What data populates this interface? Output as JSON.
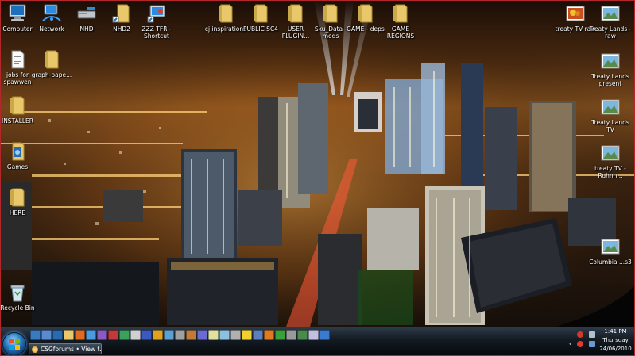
{
  "desktop": {
    "icons": [
      {
        "label": "Computer",
        "icon": "computer-icon"
      },
      {
        "label": "Network",
        "icon": "network-icon"
      },
      {
        "label": "NHD",
        "icon": "drive-icon"
      },
      {
        "label": "NHD2",
        "icon": "folder-shortcut-icon"
      },
      {
        "label": "ZZZ TFR - Shortcut",
        "icon": "shortcut-icon"
      },
      {
        "label": "cj inspirations",
        "icon": "folder-icon"
      },
      {
        "label": "PUBLIC SC4",
        "icon": "folder-icon"
      },
      {
        "label": "USER PLUGIN...",
        "icon": "folder-icon"
      },
      {
        "label": "Sku_Data - mods",
        "icon": "folder-icon"
      },
      {
        "label": "GAME - deps",
        "icon": "folder-icon"
      },
      {
        "label": "GAME REGIONS",
        "icon": "folder-icon"
      },
      {
        "label": "treaty TV raw",
        "icon": "image-icon"
      },
      {
        "label": "Treaty Lands - raw",
        "icon": "image-icon"
      },
      {
        "label": "jobs for spawwen",
        "icon": "document-icon"
      },
      {
        "label": "graph-pape...",
        "icon": "folder-icon"
      },
      {
        "label": "Treaty Lands present",
        "icon": "image-icon"
      },
      {
        "label": "INSTALLER",
        "icon": "folder-icon"
      },
      {
        "label": "Treaty Lands TV",
        "icon": "image-icon"
      },
      {
        "label": "Games",
        "icon": "games-icon"
      },
      {
        "label": "treaty TV - Ruhnn...",
        "icon": "image-icon"
      },
      {
        "label": "HERE",
        "icon": "folder-icon"
      },
      {
        "label": "Columbia ...s3",
        "icon": "image-icon"
      },
      {
        "label": "Recycle Bin",
        "icon": "recycle-bin-icon"
      }
    ]
  },
  "taskbar": {
    "start": "start-orb-icon",
    "task_button": "CSGforums • View t...",
    "clock": {
      "time": "1:41 PM",
      "day": "Thursday",
      "date": "24/06/2010"
    }
  },
  "colors": {
    "frame": "#b3262a",
    "taskbar": "#141b23",
    "folder": "#e8c86a"
  }
}
